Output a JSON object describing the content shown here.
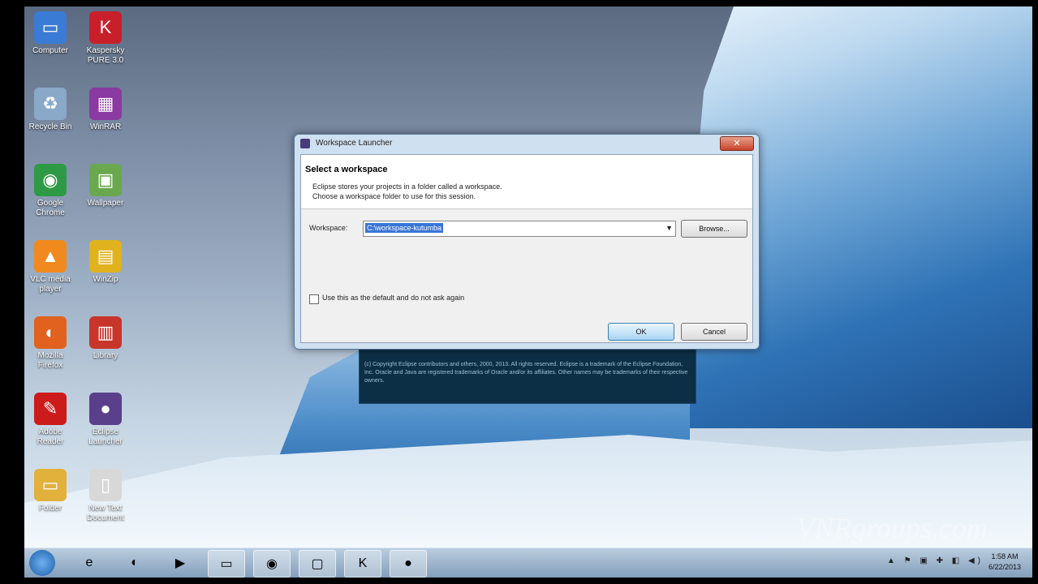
{
  "desktop": {
    "icons": [
      {
        "label": "Computer",
        "icon": "computer-icon",
        "color": "#3a7bd5",
        "glyph": "▭"
      },
      {
        "label": "Kaspersky PURE 3.0",
        "icon": "kaspersky-icon",
        "color": "#c8202a",
        "glyph": "K"
      },
      {
        "label": "Recycle Bin",
        "icon": "recycle-bin-icon",
        "color": "#8aa8c8",
        "glyph": "♻"
      },
      {
        "label": "WinRAR",
        "icon": "winrar-icon",
        "color": "#8a3aa0",
        "glyph": "▦"
      },
      {
        "label": "Google Chrome",
        "icon": "chrome-icon",
        "color": "#2f9a45",
        "glyph": "◉"
      },
      {
        "label": "Wallpaper",
        "icon": "image-file-icon",
        "color": "#6aa84f",
        "glyph": "▣"
      },
      {
        "label": "VLC media player",
        "icon": "vlc-icon",
        "color": "#f08a1e",
        "glyph": "▲"
      },
      {
        "label": "WinZip",
        "icon": "winzip-icon",
        "color": "#e0b21e",
        "glyph": "▤"
      },
      {
        "label": "Mozilla Firefox",
        "icon": "firefox-icon",
        "color": "#e0621e",
        "glyph": "◐"
      },
      {
        "label": "Library",
        "icon": "library-icon",
        "color": "#c8352a",
        "glyph": "▥"
      },
      {
        "label": "Adobe Reader",
        "icon": "adobe-reader-icon",
        "color": "#cc1b1b",
        "glyph": "✎"
      },
      {
        "label": "Eclipse Launcher",
        "icon": "eclipse-icon",
        "color": "#5a3f8a",
        "glyph": "●"
      },
      {
        "label": "Folder",
        "icon": "folder-icon",
        "color": "#e2b13c",
        "glyph": "▭"
      },
      {
        "label": "New Text Document",
        "icon": "text-document-icon",
        "color": "#d8d8d8",
        "glyph": "▯"
      }
    ]
  },
  "splash": {
    "copyright": "(c) Copyright Eclipse contributors and others, 2000, 2013. All rights reserved. Eclipse is a trademark of the Eclipse Foundation, Inc. Oracle and Java are registered trademarks of Oracle and/or its affiliates. Other names may be trademarks of their respective owners."
  },
  "dialog": {
    "title": "Workspace Launcher",
    "close": "✕",
    "heading": "Select a workspace",
    "desc1": "Eclipse stores your projects in a folder called a workspace.",
    "desc2": "Choose a workspace folder to use for this session.",
    "workspace_label": "Workspace:",
    "workspace_value": "C:\\workspace-kutumba",
    "browse": "Browse...",
    "default_checkbox": "Use this as the default and do not ask again",
    "default_checked": false,
    "ok": "OK",
    "cancel": "Cancel"
  },
  "taskbar": {
    "items": [
      {
        "icon": "ie-icon",
        "glyph": "e",
        "active": false
      },
      {
        "icon": "firefox-icon",
        "glyph": "◐",
        "active": false
      },
      {
        "icon": "media-player-icon",
        "glyph": "▶",
        "active": false
      },
      {
        "icon": "explorer-icon",
        "glyph": "▭",
        "active": true
      },
      {
        "icon": "chrome-icon",
        "glyph": "◉",
        "active": true
      },
      {
        "icon": "window-icon",
        "glyph": "▢",
        "active": true
      },
      {
        "icon": "kaspersky-icon",
        "glyph": "K",
        "active": true
      },
      {
        "icon": "eclipse-icon",
        "glyph": "●",
        "active": true
      }
    ],
    "tray": "▲ ⚑ ▣ ✚ ◧ ◀)",
    "time": "1:58 AM",
    "date": "6/22/2013"
  },
  "watermark": "VNRgroups.com"
}
